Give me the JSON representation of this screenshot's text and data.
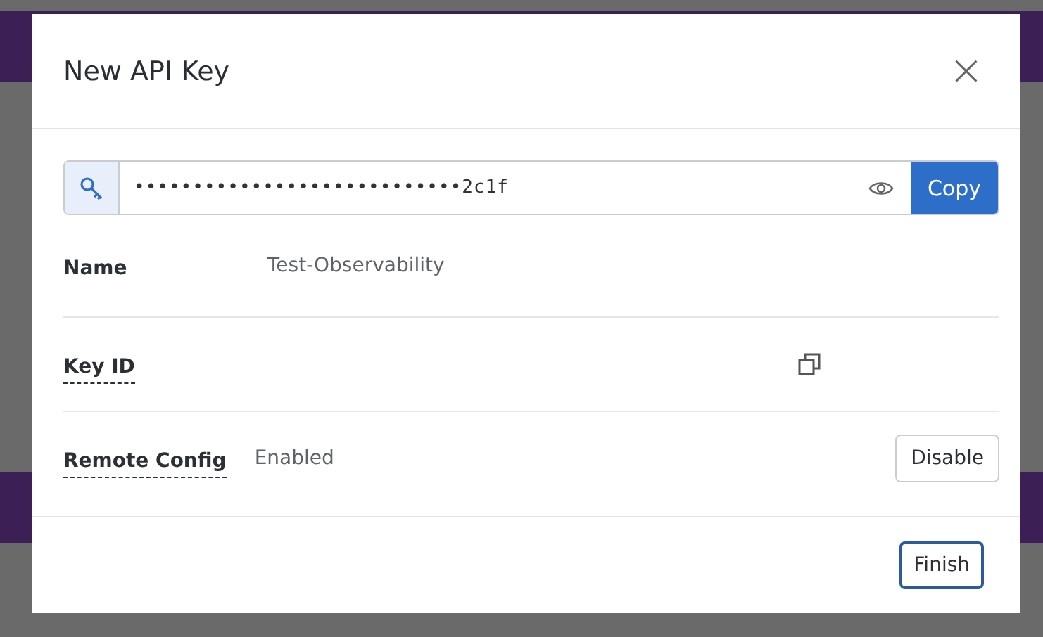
{
  "dialog": {
    "title": "New API Key",
    "close": "×",
    "api_key": {
      "value": "••••••••••••••••••••••••••••2c1f",
      "copy_button": "Copy"
    },
    "rows": [
      {
        "kind": "text",
        "label": "Name",
        "underlined": false,
        "value": "Test-Observability"
      },
      {
        "kind": "copy",
        "label": "Key ID",
        "underlined": true
      },
      {
        "kind": "action",
        "label": "Remote Config",
        "underlined": true,
        "value": "Enabled",
        "button": "Disable"
      }
    ],
    "footer": {
      "button": "Finish"
    }
  }
}
